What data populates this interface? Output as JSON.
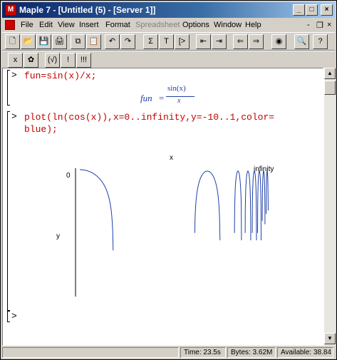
{
  "window": {
    "title": "Maple 7 - [Untitled (5) - [Server 1]]",
    "app_icon": "maple-leaf-icon"
  },
  "title_controls": {
    "minimize": "_",
    "maximize": "□",
    "close": "×"
  },
  "menus": [
    "File",
    "Edit",
    "View",
    "Insert",
    "Format",
    "Spreadsheet",
    "Options",
    "Window",
    "Help"
  ],
  "menu_disabled": [
    "Spreadsheet"
  ],
  "menu_controls": {
    "minimize": "-",
    "restore": "❐",
    "close": "×"
  },
  "toolbar1": {
    "buttons": [
      {
        "name": "new-icon",
        "glyph": "🗋"
      },
      {
        "name": "open-icon",
        "glyph": "📂"
      },
      {
        "name": "save-icon",
        "glyph": "💾"
      },
      {
        "name": "print-icon",
        "glyph": "🖨"
      },
      {
        "name": "copy-icon",
        "glyph": "⧉"
      },
      {
        "name": "paste-icon",
        "glyph": "📋"
      },
      {
        "name": "undo-icon",
        "glyph": "↶"
      },
      {
        "name": "redo-icon",
        "glyph": "↷"
      },
      {
        "name": "sum-icon",
        "glyph": "Σ"
      },
      {
        "name": "text-icon",
        "glyph": "T"
      },
      {
        "name": "prompt-icon",
        "glyph": "[>"
      },
      {
        "name": "indent-left-icon",
        "glyph": "⇤"
      },
      {
        "name": "indent-right-icon",
        "glyph": "⇥"
      },
      {
        "name": "back-icon",
        "glyph": "⇐"
      },
      {
        "name": "forward-icon",
        "glyph": "⇒"
      },
      {
        "name": "stop-icon",
        "glyph": "◉"
      },
      {
        "name": "zoom-icon",
        "glyph": "🔍"
      },
      {
        "name": "help-icon",
        "glyph": "?"
      }
    ]
  },
  "toolbar2": {
    "buttons": [
      {
        "name": "math-mode-icon",
        "glyph": "x"
      },
      {
        "name": "maple-mode-icon",
        "glyph": "✿"
      },
      {
        "name": "check-syntax-icon",
        "glyph": "(√)"
      },
      {
        "name": "execute-icon",
        "glyph": "!"
      },
      {
        "name": "execute-all-icon",
        "glyph": "!!!"
      }
    ]
  },
  "worksheet": {
    "cmd1": "fun=sin(x)/x;",
    "output1_lhs": "fun",
    "output1_eq": "=",
    "output1_num": "sin(x)",
    "output1_den": "x",
    "cmd2_line1": "plot(ln(cos(x)),x=0..infinity,y=-10..1,color=",
    "cmd2_line2": "blue);",
    "prompt": "[>",
    "plot": {
      "xlabel": "x",
      "ylabel": "y",
      "ytick_label": "0",
      "xtick_right": "infinity"
    }
  },
  "chart_data": {
    "type": "line",
    "title": "",
    "xlabel": "x",
    "ylabel": "y",
    "ylim": [
      -10,
      1
    ],
    "x_range": "0..infinity",
    "color": "#1f3fa8",
    "series": [
      {
        "expression": "ln(cos(x))"
      }
    ]
  },
  "status": {
    "time": "Time: 23.5s",
    "bytes": "Bytes: 3.62M",
    "available": "Available: 38.84"
  }
}
